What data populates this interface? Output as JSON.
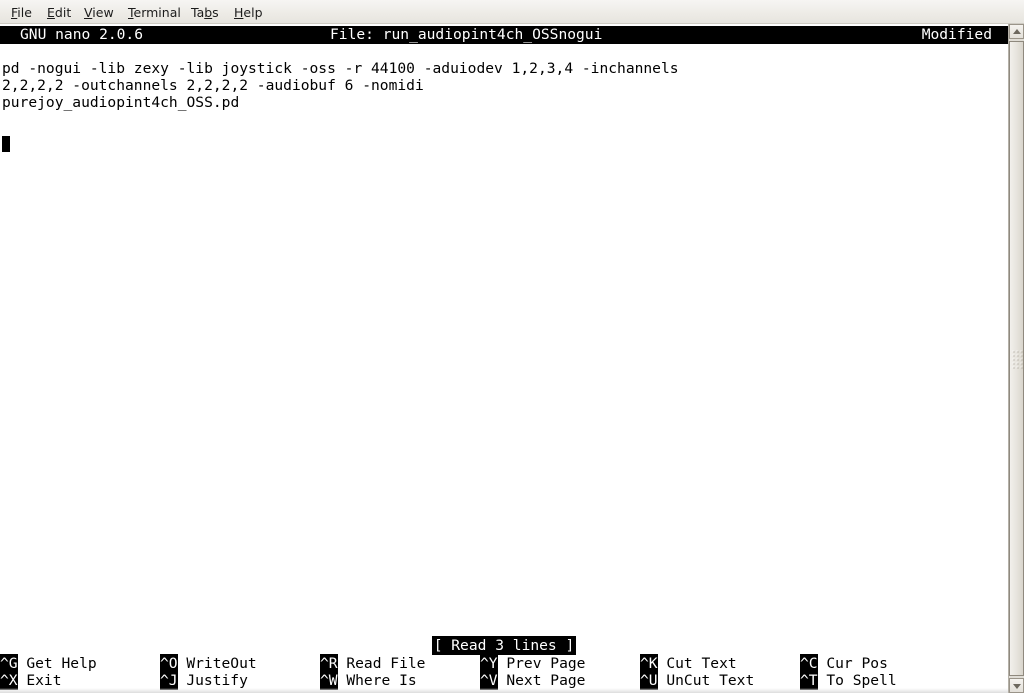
{
  "window": {
    "menubar": [
      {
        "name": "file",
        "pre": "",
        "mnemonic": "F",
        "post": "ile"
      },
      {
        "name": "edit",
        "pre": "",
        "mnemonic": "E",
        "post": "dit"
      },
      {
        "name": "view",
        "pre": "",
        "mnemonic": "V",
        "post": "iew"
      },
      {
        "name": "terminal",
        "pre": "",
        "mnemonic": "T",
        "post": "erminal"
      },
      {
        "name": "tabs",
        "pre": "Ta",
        "mnemonic": "b",
        "post": "s"
      },
      {
        "name": "help",
        "pre": "",
        "mnemonic": "H",
        "post": "elp"
      }
    ]
  },
  "nano": {
    "titlebar": {
      "version": "GNU nano 2.0.6",
      "file": "File: run_audiopint4ch_OSSnogui",
      "modified": "Modified"
    },
    "buffer": {
      "lines": [
        "pd -nogui -lib zexy -lib joystick -oss -r 44100 -aduiodev 1,2,3,4 -inchannels",
        "2,2,2,2 -outchannels 2,2,2,2 -audiobuf 6 -nomidi",
        "purejoy_audiopint4ch_OSS.pd"
      ]
    },
    "status_message": "[ Read 3 lines ]",
    "shortcuts": {
      "row1": [
        {
          "key": "^G",
          "label": " Get Help"
        },
        {
          "key": "^O",
          "label": " WriteOut"
        },
        {
          "key": "^R",
          "label": " Read File"
        },
        {
          "key": "^Y",
          "label": " Prev Page"
        },
        {
          "key": "^K",
          "label": " Cut Text"
        },
        {
          "key": "^C",
          "label": " Cur Pos"
        }
      ],
      "row2": [
        {
          "key": "^X",
          "label": " Exit"
        },
        {
          "key": "^J",
          "label": " Justify"
        },
        {
          "key": "^W",
          "label": " Where Is"
        },
        {
          "key": "^V",
          "label": " Next Page"
        },
        {
          "key": "^U",
          "label": " UnCut Text"
        },
        {
          "key": "^T",
          "label": " To Spell"
        }
      ]
    }
  },
  "scrollbar": {
    "up_arrow": "scroll-up-arrow",
    "down_arrow": "scroll-down-arrow"
  },
  "colors": {
    "terminal_bg": "#ffffff",
    "terminal_fg": "#000000",
    "reverse_bg": "#000000",
    "reverse_fg": "#ffffff",
    "chrome_bg": "#eeece7"
  }
}
